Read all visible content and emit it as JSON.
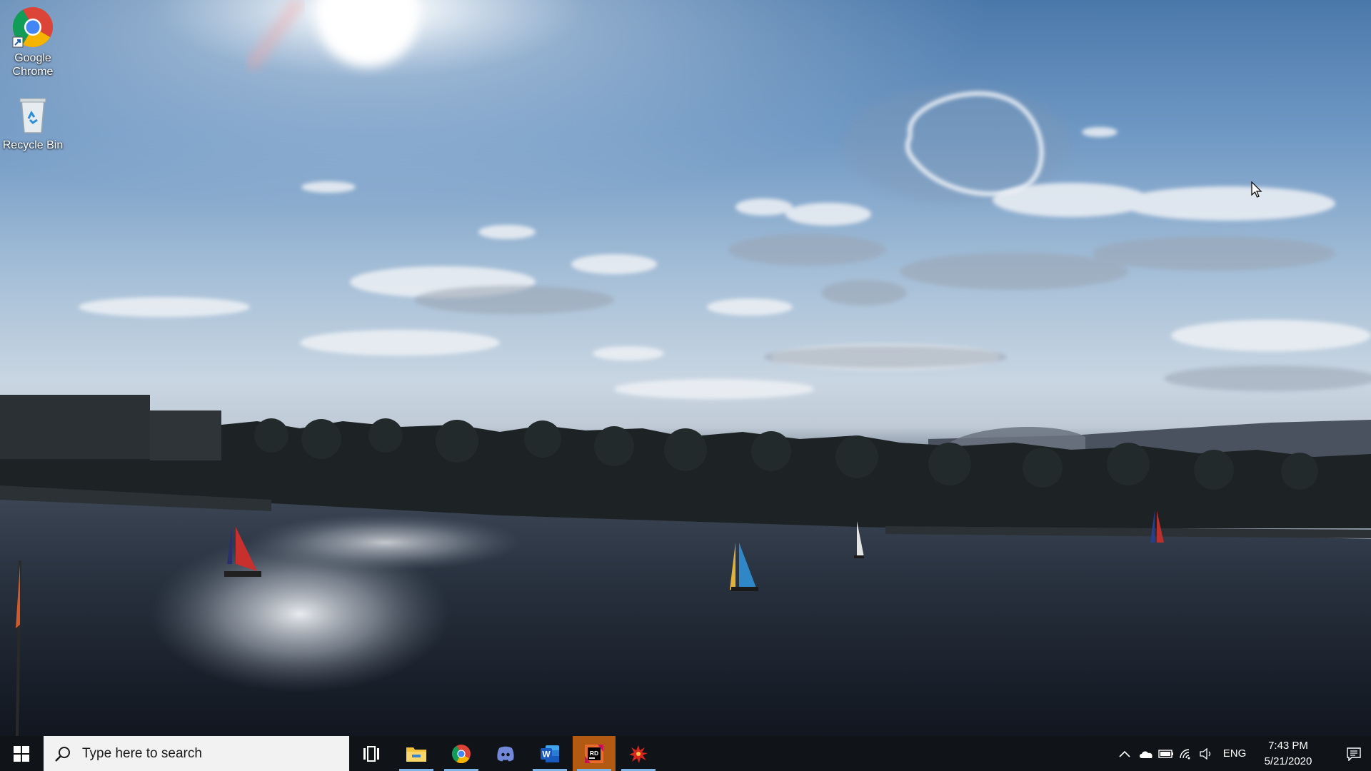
{
  "desktop": {
    "icons": [
      {
        "label_line1": "Google",
        "label_line2": "Chrome",
        "icon": "google-chrome-icon"
      },
      {
        "label_line1": "Recycle Bin",
        "label_line2": "",
        "icon": "recycle-bin-icon"
      }
    ]
  },
  "taskbar": {
    "start_icon": "windows-logo-icon",
    "search": {
      "placeholder": "Type here to search",
      "icon": "search-icon"
    },
    "apps": [
      {
        "name": "task-view",
        "icon": "task-view-icon",
        "active": false
      },
      {
        "name": "file-explorer",
        "icon": "folder-icon",
        "active": true
      },
      {
        "name": "google-chrome",
        "icon": "chrome-icon",
        "active": true
      },
      {
        "name": "discord",
        "icon": "discord-icon",
        "active": false
      },
      {
        "name": "microsoft-word",
        "icon": "word-icon",
        "active": true
      },
      {
        "name": "jetbrains-rider",
        "icon": "rider-icon",
        "active": true
      },
      {
        "name": "app-red-splash",
        "icon": "red-splash-icon",
        "active": true
      }
    ],
    "tray": {
      "icons": [
        "chevron-up-icon",
        "onedrive-icon",
        "battery-icon",
        "wifi-icon",
        "volume-icon"
      ],
      "language": "ENG",
      "time": "7:43 PM",
      "date": "5/21/2020",
      "notification_icon": "notification-icon"
    }
  },
  "colors": {
    "taskbar_bg": "#101418",
    "search_bg": "#f2f2f2",
    "active_underline": "#7fb4e6",
    "rider_active_bg": "#b35a12"
  }
}
